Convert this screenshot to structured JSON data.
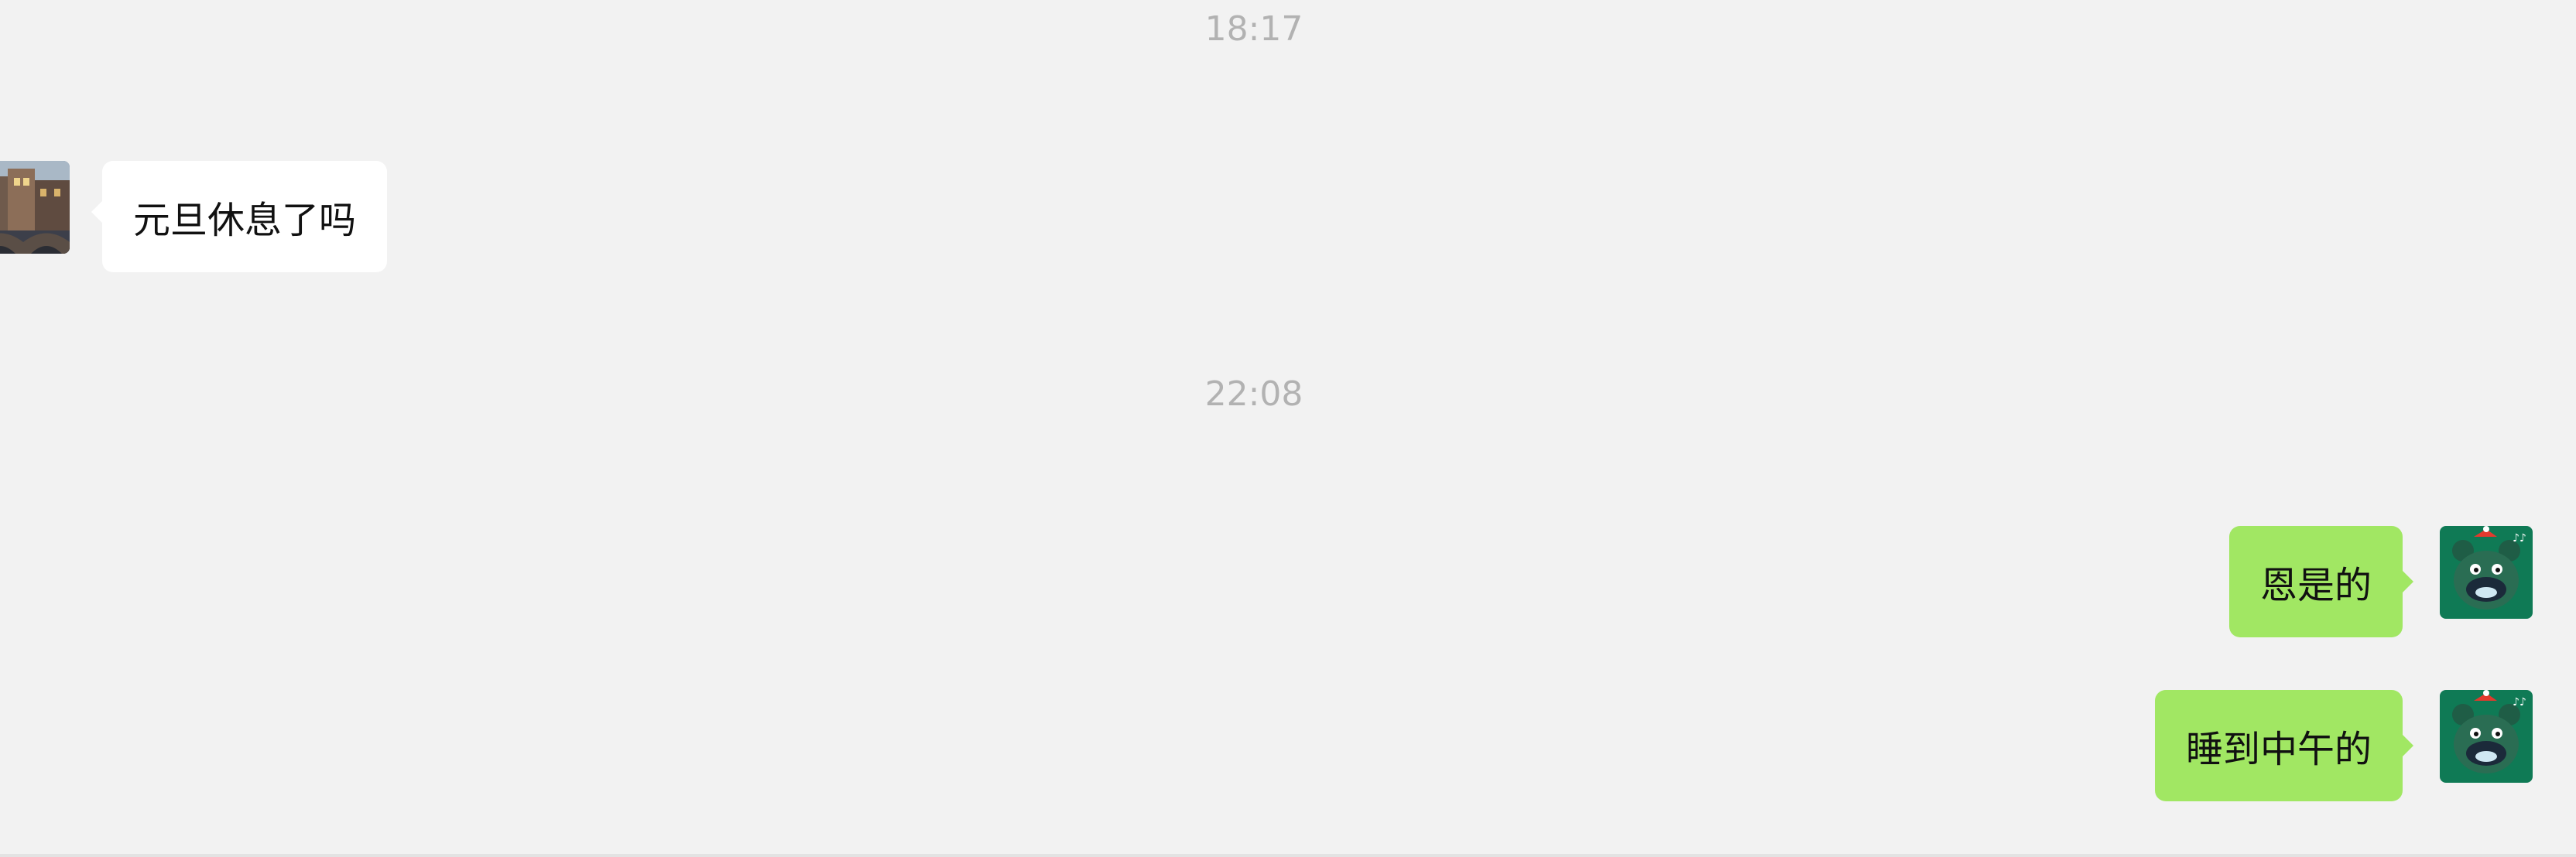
{
  "chat": {
    "timestamps": [
      "18:17",
      "22:08"
    ],
    "messages": [
      {
        "direction": "incoming",
        "text": "元旦休息了吗",
        "avatar": "city-photo-avatar"
      },
      {
        "direction": "outgoing",
        "text": "恩是的",
        "avatar": "green-bear-avatar"
      },
      {
        "direction": "outgoing",
        "text": "睡到中午的",
        "avatar": "green-bear-avatar"
      }
    ]
  },
  "colors": {
    "background": "#f2f2f2",
    "incoming_bubble": "#ffffff",
    "outgoing_bubble": "#a1e763",
    "timestamp_text": "#b2b2b2",
    "message_text": "#111111"
  }
}
